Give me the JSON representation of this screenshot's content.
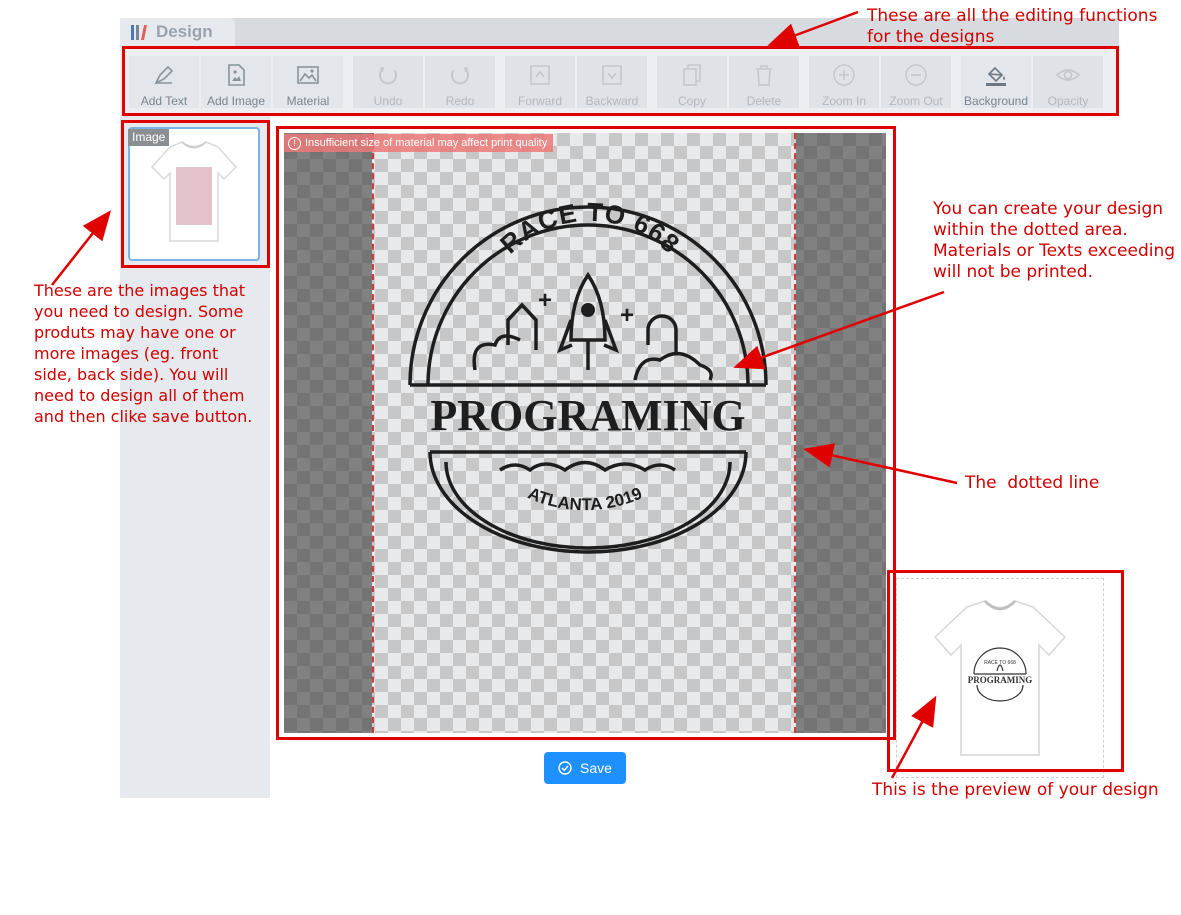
{
  "tab": {
    "title": "Design"
  },
  "toolbar": {
    "items": [
      {
        "label": "Add Text",
        "icon": "add-text-icon"
      },
      {
        "label": "Add Image",
        "icon": "add-image-icon"
      },
      {
        "label": "Material",
        "icon": "material-icon"
      },
      {
        "label": "Undo",
        "icon": "undo-icon"
      },
      {
        "label": "Redo",
        "icon": "redo-icon"
      },
      {
        "label": "Forward",
        "icon": "forward-icon"
      },
      {
        "label": "Backward",
        "icon": "backward-icon"
      },
      {
        "label": "Copy",
        "icon": "copy-icon"
      },
      {
        "label": "Delete",
        "icon": "delete-icon"
      },
      {
        "label": "Zoom In",
        "icon": "zoom-in-icon"
      },
      {
        "label": "Zoom Out",
        "icon": "zoom-out-icon"
      },
      {
        "label": "Background",
        "icon": "background-icon"
      },
      {
        "label": "Opacity",
        "icon": "opacity-icon"
      }
    ]
  },
  "sidebar": {
    "thumbnail_badge": "Image"
  },
  "canvas": {
    "warning": "Insufficient size of material may affect print quality",
    "design": {
      "top_text": "RACE TO 668",
      "main_text": "PROGRAMING",
      "bottom_text": "ATLANTA 2019"
    }
  },
  "preview": {
    "top_text": "RACE TO 668",
    "main_text": "PROGRAMING"
  },
  "save": {
    "label": "Save"
  },
  "annotations": {
    "toolbar_note": [
      "These are all the editing functions",
      "for the designs"
    ],
    "images_note": [
      "These are the images that",
      "you need to design. Some",
      "produts may have one or",
      "more images (eg. front",
      "side, back side). You will",
      "need to design all of them",
      "and then clike save button."
    ],
    "area_note": [
      "You can create your design",
      "within the dotted area.",
      "Materials or Texts exceeding",
      "will not be printed."
    ],
    "dotted_note": "The  dotted line",
    "preview_note": "This is the preview of your design"
  },
  "colors": {
    "annotation_red": "#e00000",
    "save_blue": "#1e90ff",
    "dotted_red": "#d23a3a"
  }
}
